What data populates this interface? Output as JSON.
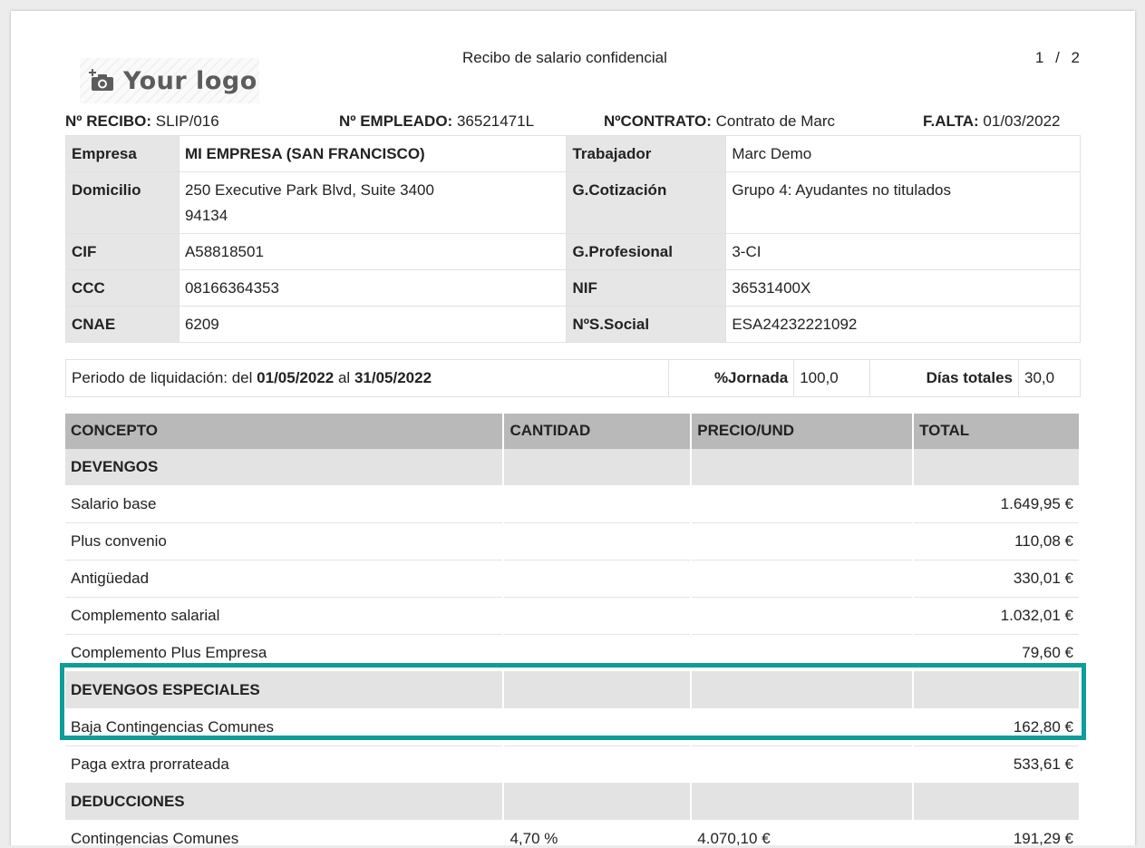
{
  "header": {
    "logo_text": "Your logo",
    "title": "Recibo de salario confidencial",
    "page_current": "1",
    "page_sep": "/",
    "page_total": "2"
  },
  "meta": {
    "receipt_label": "Nº RECIBO:",
    "receipt_value": "SLIP/016",
    "employee_label": "Nº EMPLEADO:",
    "employee_value": "36521471L",
    "contract_label": "NºCONTRATO:",
    "contract_value": "Contrato de Marc",
    "start_label": "F.ALTA:",
    "start_value": "01/03/2022"
  },
  "company": {
    "empresa_label": "Empresa",
    "empresa_value": "MI EMPRESA (SAN FRANCISCO)",
    "domicilio_label": "Domicilio",
    "domicilio_line1": "250 Executive Park Blvd, Suite 3400",
    "domicilio_line2": "94134",
    "cif_label": "CIF",
    "cif_value": "A58818501",
    "ccc_label": "CCC",
    "ccc_value": "08166364353",
    "cnae_label": "CNAE",
    "cnae_value": "6209"
  },
  "worker": {
    "trabajador_label": "Trabajador",
    "trabajador_value": "Marc Demo",
    "cotizacion_label": "G.Cotización",
    "cotizacion_value": "Grupo 4: Ayudantes no titulados",
    "profesional_label": "G.Profesional",
    "profesional_value": "3-CI",
    "nif_label": "NIF",
    "nif_value": "36531400X",
    "ss_label": "NºS.Social",
    "ss_value": "ESA24232221092"
  },
  "period": {
    "prefix": "Periodo de liquidación: del ",
    "from": "01/05/2022",
    "middle": " al ",
    "to": "31/05/2022",
    "jornada_label": "%Jornada",
    "jornada_value": "100,0",
    "dias_label": "Días totales",
    "dias_value": "30,0"
  },
  "concepts": {
    "headers": {
      "concepto": "CONCEPTO",
      "cantidad": "CANTIDAD",
      "precio": "PRECIO/UND",
      "total": "TOTAL"
    },
    "devengos_title": "DEVENGOS",
    "rows": [
      {
        "concept": "Salario base",
        "qty": "",
        "price": "",
        "total": "1.649,95 €"
      },
      {
        "concept": "Plus convenio",
        "qty": "",
        "price": "",
        "total": "110,08 €"
      },
      {
        "concept": "Antigüedad",
        "qty": "",
        "price": "",
        "total": "330,01 €"
      },
      {
        "concept": "Complemento salarial",
        "qty": "",
        "price": "",
        "total": "1.032,01 €"
      },
      {
        "concept": "Complemento Plus Empresa",
        "qty": "",
        "price": "",
        "total": "79,60 €"
      }
    ],
    "especiales_title": "DEVENGOS ESPECIALES",
    "especiales_rows": [
      {
        "concept": "Baja Contingencias Comunes",
        "qty": "",
        "price": "",
        "total": "162,80 €"
      },
      {
        "concept": "Paga extra prorrateada",
        "qty": "",
        "price": "",
        "total": "533,61 €"
      }
    ],
    "deducciones_title": "DEDUCCIONES",
    "deducciones_rows": [
      {
        "concept": "Contingencias Comunes",
        "qty": "4,70 %",
        "price": "4.070,10 €",
        "total": "191,29 €"
      }
    ]
  },
  "colors": {
    "highlight": "#0f9d9a",
    "header_bg": "#b9b9b9",
    "label_bg": "#e6e6e6"
  }
}
